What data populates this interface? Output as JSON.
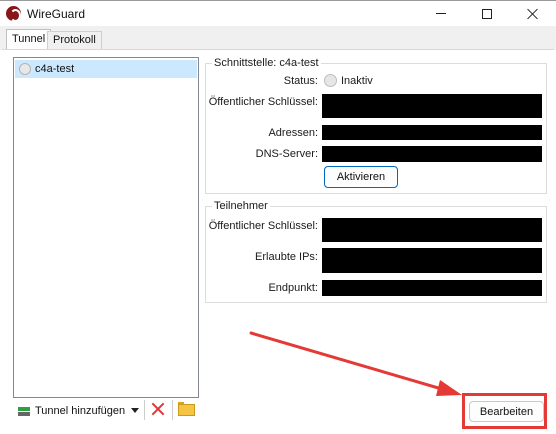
{
  "window": {
    "title": "WireGuard",
    "icon": "wireguard-logo-icon",
    "controls": [
      "minimize-icon",
      "maximize-icon",
      "close-icon"
    ]
  },
  "tabs": [
    {
      "label": "Tunnel",
      "active": true
    },
    {
      "label": "Protokoll",
      "active": false
    }
  ],
  "tunnels": [
    {
      "name": "c4a-test",
      "selected": true
    }
  ],
  "toolbar": {
    "add_label": "Tunnel hinzufügen",
    "icons": [
      "add-tunnel-icon",
      "dropdown-arrow-icon",
      "delete-icon",
      "folder-icon"
    ]
  },
  "interface": {
    "title": "Schnittstelle: c4a-test",
    "status_label": "Status:",
    "status_value": "Inaktiv",
    "public_key_label": "Öffentlicher Schlüssel:",
    "addresses_label": "Adressen:",
    "dns_label": "DNS-Server:",
    "activate_label": "Aktivieren"
  },
  "peer": {
    "title": "Teilnehmer",
    "public_key_label": "Öffentlicher Schlüssel:",
    "allowed_ips_label": "Erlaubte IPs:",
    "endpoint_label": "Endpunkt:"
  },
  "edit_label": "Bearbeiten",
  "colors": {
    "selection": "#cce8ff",
    "accent": "#0067c0",
    "annotation": "#e53935",
    "delete": "#e23636",
    "redaction": "#000000"
  }
}
